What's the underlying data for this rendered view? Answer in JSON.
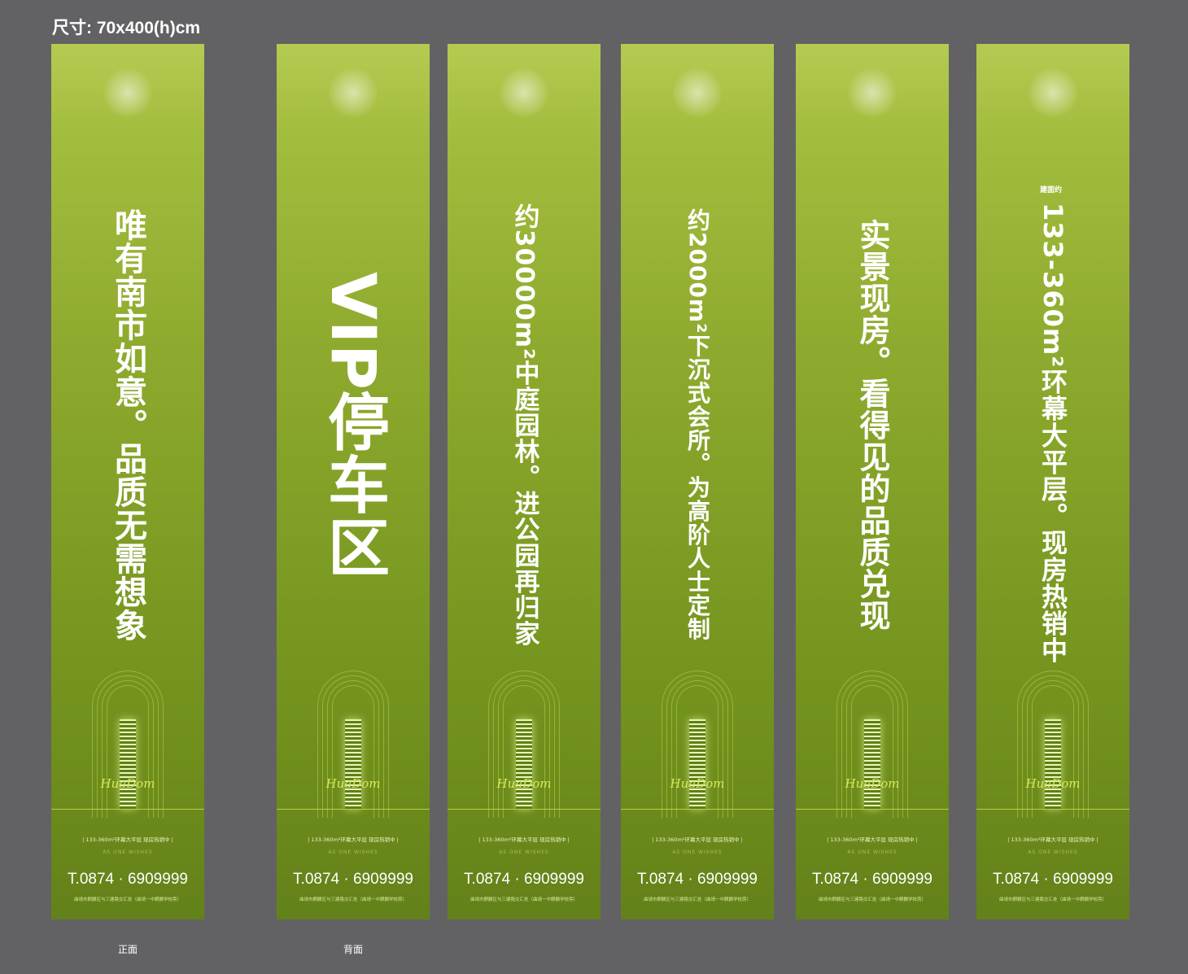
{
  "size_label": "尺寸: 70x400(h)cm",
  "front_label": "正面",
  "back_label": "背面",
  "brand_signature": "HuaDom",
  "tagline": "| 133-360m²环幕大平层 现房热销中 |",
  "wishes": "AS ONE WISHES",
  "phone": "T.0874 · 6909999",
  "address": "曲靖市麒麟区与三建路交汇处（曲靖一中麒麟学校旁）",
  "banners": [
    {
      "headline": "唯有南市如意。品质无需想象"
    },
    {
      "headline": "VIP停车区"
    },
    {
      "headline": "约30000m²中庭园林。进公园再归家"
    },
    {
      "headline": "约2000m²下沉式会所。为高阶人士定制"
    },
    {
      "headline": "实景现房。看得见的品质兑现"
    },
    {
      "prefix": "建面约",
      "headline": "133-360m²环幕大平层。现房热销中"
    }
  ],
  "colors": {
    "background": "#626264",
    "banner_top": "#b4cb52",
    "banner_bottom": "#63811a",
    "accent": "#d8e85a"
  }
}
